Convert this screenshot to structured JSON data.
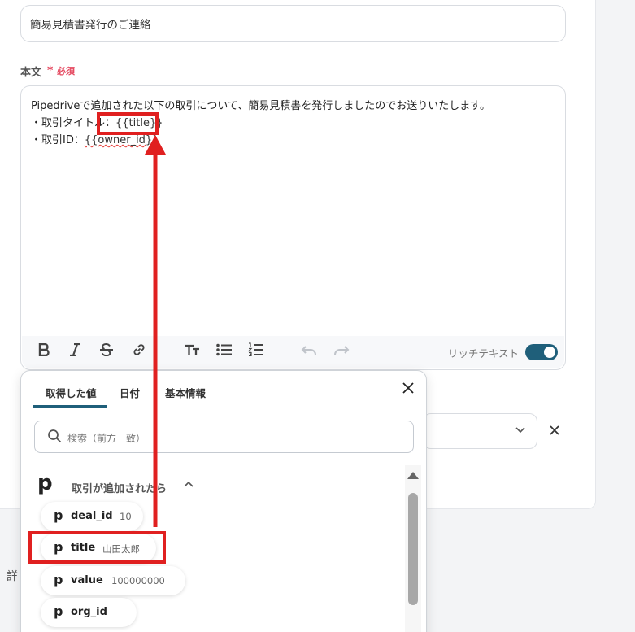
{
  "form": {
    "subject_value": "簡易見積書発行のご連絡",
    "body_label": "本文",
    "required_mark": "*",
    "required_text": "必須",
    "body_lines": [
      "Pipedriveで追加された以下の取引について、簡易見積書を発行しましたのでお送りいたします。",
      "・取引タイトル：",
      "{{title}}",
      "・取引ID：",
      "{{owner_id}}"
    ],
    "rich_text_label": "リッチテキスト",
    "rich_text_enabled": true,
    "detail_label_partial": "詳"
  },
  "toolbar": {
    "icons": [
      "bold-icon",
      "italic-icon",
      "strikethrough-icon",
      "link-icon",
      "text-size-icon",
      "bullet-list-icon",
      "numbered-list-icon",
      "undo-icon",
      "redo-icon"
    ]
  },
  "popup": {
    "tabs": [
      "取得した値",
      "日付",
      "基本情報"
    ],
    "active_tab": "取得した値",
    "search_placeholder": "検索（前方一致）",
    "group_label": "取引が追加されたら",
    "items": [
      {
        "key": "deal_id",
        "value": "10"
      },
      {
        "key": "title",
        "value": "山田太郎"
      },
      {
        "key": "value",
        "value": "100000000"
      },
      {
        "key": "org_id",
        "value": ""
      }
    ]
  },
  "colors": {
    "accent": "#1f5f7a",
    "required": "#e5485f",
    "annotation": "#e02020"
  }
}
